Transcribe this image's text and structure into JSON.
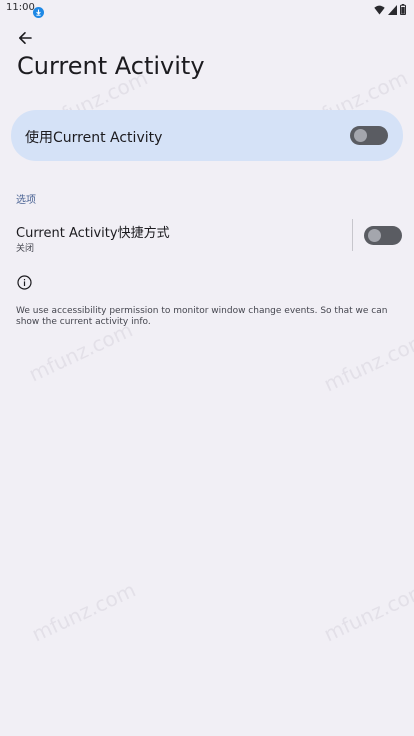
{
  "status_bar": {
    "time": "11:00",
    "icons": [
      "download-icon",
      "wifi-icon",
      "cellular-icon",
      "battery-icon"
    ]
  },
  "header": {
    "back_icon": "arrow-left-icon",
    "title": "Current Activity"
  },
  "main_switch": {
    "label": "使用Current Activity",
    "enabled": false
  },
  "section": {
    "header": "选项"
  },
  "shortcut": {
    "title": "Current Activity快捷方式",
    "summary": "关闭",
    "enabled": false
  },
  "info": {
    "icon": "info-icon",
    "text": "We use accessibility permission to monitor window change events. So that we can show the current activity info."
  },
  "watermark": "mfunz.com",
  "colors": {
    "background": "#F1EFF5",
    "card": "#D5E2F7",
    "section_header": "#4A6394",
    "switch_track_off": "#5A5C62",
    "switch_thumb_off": "#A4A6AD",
    "download_badge": "#1E88E5"
  }
}
